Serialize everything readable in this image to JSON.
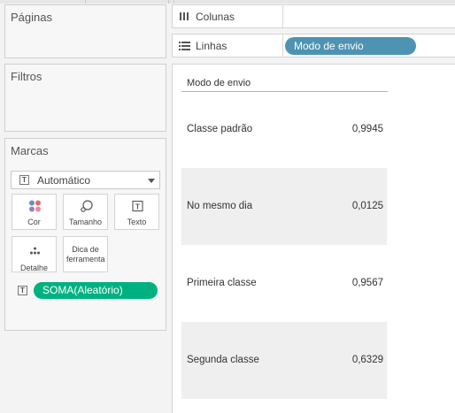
{
  "cards": {
    "pages_title": "Páginas",
    "filters_title": "Filtros",
    "marks_title": "Marcas"
  },
  "marks": {
    "type_label": "Automático",
    "buttons": [
      {
        "label": "Cor",
        "icon": "color-dots-icon"
      },
      {
        "label": "Tamanho",
        "icon": "size-bubble-icon"
      },
      {
        "label": "Texto",
        "icon": "text-t-icon"
      },
      {
        "label": "Detalhe",
        "icon": "detail-dots-icon"
      },
      {
        "label": "Dica de ferramenta",
        "icon": ""
      }
    ],
    "field_pill": "SOMA(Aleatório)"
  },
  "shelves": {
    "columns_label": "Colunas",
    "rows_label": "Linhas",
    "rows_pill": "Modo de envio"
  },
  "colors": {
    "measure_pill": "#00b180",
    "dimension_pill": "#4f93b3",
    "band_shade": "#efefef"
  },
  "table": {
    "header": "Modo de envio",
    "rows": [
      {
        "category": "Classe padrão",
        "value": "0,9945"
      },
      {
        "category": "No mesmo dia",
        "value": "0,0125"
      },
      {
        "category": "Primeira classe",
        "value": "0,9567"
      },
      {
        "category": "Segunda classe",
        "value": "0,6329"
      }
    ]
  }
}
